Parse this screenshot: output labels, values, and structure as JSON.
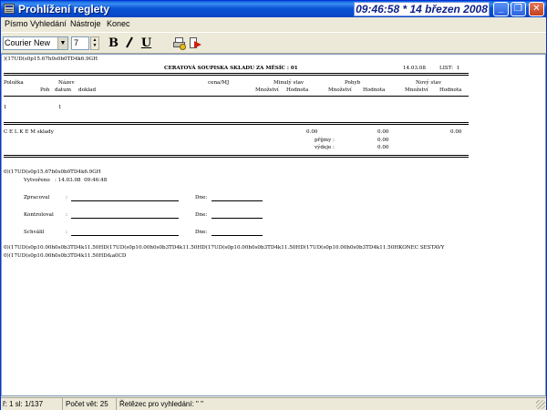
{
  "window": {
    "title": "Prohlížení reglety",
    "clock": "09:46:58 * 14 březen 2008",
    "min_label": "_",
    "max_label": "❐",
    "close_label": "✕"
  },
  "menu": [
    {
      "label": "Písmo"
    },
    {
      "label": "Vyhledání"
    },
    {
      "label": "Nástroje"
    },
    {
      "label": "Konec"
    }
  ],
  "toolbar": {
    "font_value": "Courier New",
    "size_value": "7",
    "bold_label": "B",
    "italic_label": "I",
    "underline_label": "U",
    "icons": [
      "print-preview-icon",
      "exit-icon"
    ]
  },
  "document": {
    "code1": ")(17UD(s0p15.67h0s0b0TD4k6.9GH",
    "title": "CERATOVÁ SOUPISKA SKLADU ZA MĚSÍC : 01",
    "date": "14.03.08",
    "sheet": "LIST:  1",
    "headers": {
      "polozka": "Položka",
      "nazev": "Název",
      "cena": "cena/MJ",
      "pocatecni": "Minulý stav",
      "pohyb": "Pohyb",
      "novy": "Nový stav",
      "poh": "Poh",
      "datum": "datum",
      "doklad": "doklad",
      "mnozstvi": "Množství",
      "hodnota": "Hodnota"
    },
    "row": {
      "polozka": "1",
      "nazev": "1"
    },
    "celkem": "C E L K E M sklady",
    "totals": {
      "v1": "0.00",
      "v2": "0.00",
      "v3": "0.00",
      "prijmy_label": "příjmy :",
      "prijmy": "0.00",
      "vydeje_label": "výdeje :",
      "vydeje": "0.00"
    },
    "code2": "0)(17UD(s0p15.67h0s0b0TD4k6.9GH",
    "vytvoreno_label": "Vytvořeno",
    "vytvoreno": ": 14.03.08  09:46:48",
    "sign": [
      {
        "label": "Zpracoval",
        "date_label": "Dne:"
      },
      {
        "label": "Kontroloval",
        "date_label": "Dne:"
      },
      {
        "label": "Schválil",
        "date_label": "Dne:"
      }
    ],
    "code3": "0)(17UD(s0p10.00h0s0b3TD4k11.50HD(17UD(s0p10.00h0s0b3TD4k11.50HD(17UD(s0p10.00h0s0b3TD4k11.50HD(17UD(s0p10.00h0s0b3TD4k11.50HKONEC SESTAVY",
    "code4": "0)(17UD(s0p10.00h0s0b3TD4k11.50HD&a0CD"
  },
  "status": {
    "position": "ř: 1 sl: 1/137",
    "count": "Počet vět: 25",
    "search": "Řetězec pro vyhledání: \" \""
  }
}
